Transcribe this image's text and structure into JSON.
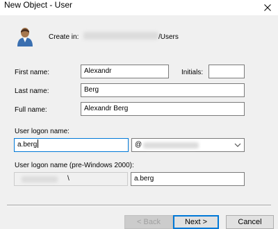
{
  "window": {
    "title": "New Object - User"
  },
  "create_in": {
    "label": "Create in:",
    "path_suffix": "/Users"
  },
  "first_name": {
    "label": "First name:",
    "value": "Alexandr"
  },
  "initials": {
    "label": "Initials:",
    "value": ""
  },
  "last_name": {
    "label": "Last name:",
    "value": "Berg"
  },
  "full_name": {
    "label": "Full name:",
    "value": "Alexandr Berg"
  },
  "logon_name": {
    "label": "User logon name:",
    "value": "a.berg",
    "domain_prefix": "@"
  },
  "pre2000": {
    "label": "User logon name (pre-Windows 2000):",
    "domain_suffix": "\\",
    "value": "a.berg"
  },
  "buttons": {
    "back": "< Back",
    "next": "Next >",
    "cancel": "Cancel"
  },
  "icons": {
    "close": "close-icon",
    "user": "user-icon",
    "dropdown": "chevron-down-icon"
  }
}
